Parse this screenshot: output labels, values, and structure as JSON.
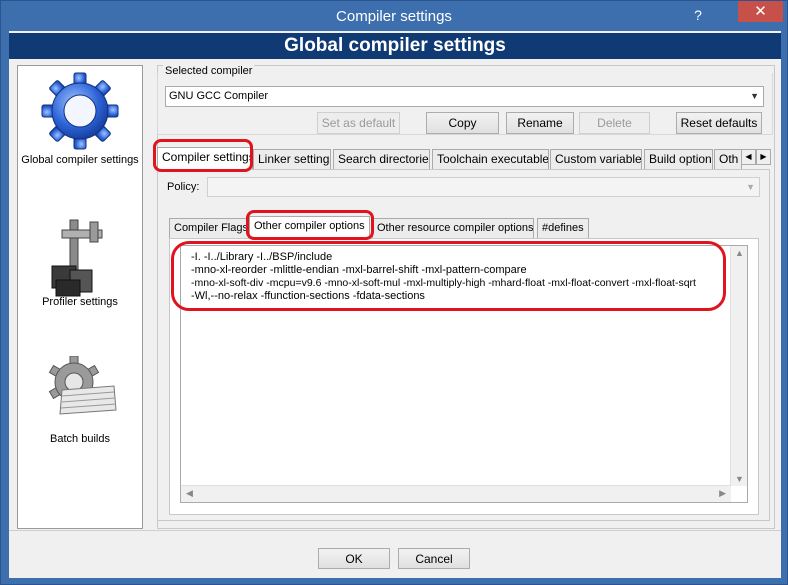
{
  "window": {
    "title": "Compiler settings",
    "help_label": "?",
    "close_label": "✕"
  },
  "header": {
    "title": "Global compiler settings"
  },
  "sidebar": {
    "items": [
      {
        "label": "Global compiler settings",
        "icon": "gear-icon"
      },
      {
        "label": "Profiler settings",
        "icon": "caliper-icon"
      },
      {
        "label": "Batch builds",
        "icon": "batch-gear-icon"
      }
    ]
  },
  "compiler": {
    "group_label": "Selected compiler",
    "selected": "GNU GCC Compiler",
    "buttons": {
      "set_default": "Set as default",
      "copy": "Copy",
      "rename": "Rename",
      "delete": "Delete",
      "reset": "Reset defaults"
    }
  },
  "tabs": [
    "Compiler settings",
    "Linker settings",
    "Search directories",
    "Toolchain executables",
    "Custom variables",
    "Build options",
    "Oth"
  ],
  "policy": {
    "label": "Policy:",
    "value": ""
  },
  "subtabs": [
    "Compiler Flags",
    "Other compiler options",
    "Other resource compiler options",
    "#defines"
  ],
  "editor": {
    "lines": [
      "-I. -I../Library -I../BSP/include",
      "-mno-xl-reorder -mlittle-endian -mxl-barrel-shift -mxl-pattern-compare",
      "-mno-xl-soft-div -mcpu=v9.6 -mno-xl-soft-mul -mxl-multiply-high -mhard-float -mxl-float-convert -mxl-float-sqrt",
      "-Wl,--no-relax -ffunction-sections -fdata-sections"
    ]
  },
  "footer": {
    "ok": "OK",
    "cancel": "Cancel"
  },
  "colors": {
    "titlebar": "#3d6fae",
    "header": "#103a73",
    "highlight": "#e0141e",
    "close": "#c7504a"
  }
}
